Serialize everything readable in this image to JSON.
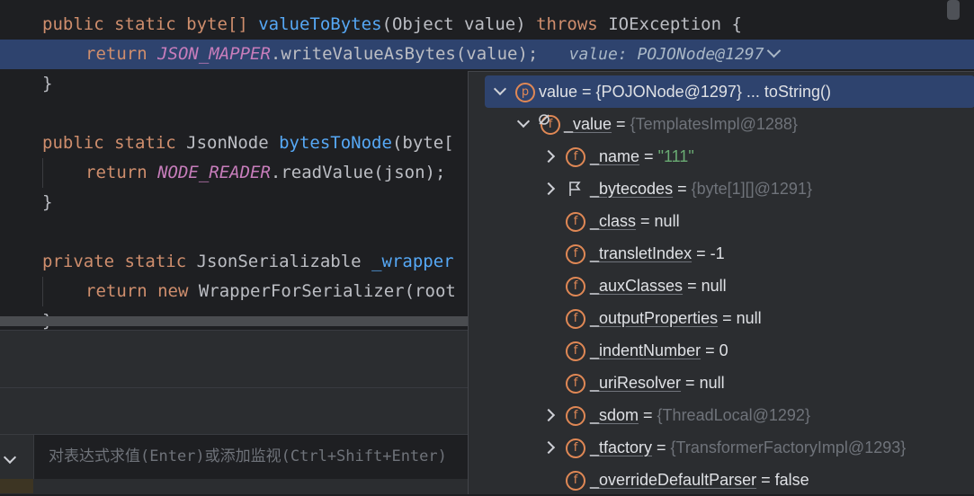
{
  "editor": {
    "lines": [
      {
        "k1": "public static ",
        "t1": "byte[] ",
        "fn": "valueToBytes",
        "rest": "(Object value) ",
        "kw2": "throws",
        "rest2": " IOException {"
      },
      {
        "ret": "return ",
        "const": "JSON_MAPPER",
        "call": ".writeValueAsBytes(value);",
        "hint": "value: POJONode@1297"
      },
      {
        "brace": "}"
      },
      {
        "k1": "public static ",
        "t1": "JsonNode ",
        "fn": "bytesToNode",
        "rest": "(byte["
      },
      {
        "ret": "return ",
        "const": "NODE_READER",
        "call": ".readValue(json);"
      },
      {
        "brace": "}"
      },
      {
        "k1": "private static ",
        "t1": "JsonSerializable ",
        "fn": "_wrapper"
      },
      {
        "ret": "return ",
        "kw": "new ",
        "call": "WrapperForSerializer(root"
      },
      {
        "brace": "}"
      }
    ]
  },
  "evaluate": {
    "placeholder": "对表达式求值(Enter)或添加监视(Ctrl+Shift+Enter)"
  },
  "popup": {
    "root": {
      "badge": "p",
      "text": "value = {POJONode@1297} ... toString()"
    },
    "value_node": {
      "badge": "f",
      "name": "_value",
      "eq": " = ",
      "ref": "{TemplatesImpl@1288}"
    },
    "fields": [
      {
        "badge": "f",
        "name": "_name",
        "eq": " = ",
        "val": "\"111\"",
        "type": "str",
        "expandable": true
      },
      {
        "badge": "flag",
        "name": "_bytecodes",
        "eq": " = ",
        "val": "{byte[1][]@1291}",
        "type": "ref",
        "expandable": true
      },
      {
        "badge": "f",
        "name": "_class",
        "eq": " = ",
        "val": "null",
        "type": "plain",
        "expandable": false
      },
      {
        "badge": "f",
        "name": "_transletIndex",
        "eq": " = ",
        "val": "-1",
        "type": "plain",
        "expandable": false
      },
      {
        "badge": "f",
        "name": "_auxClasses",
        "eq": " = ",
        "val": "null",
        "type": "plain",
        "expandable": false
      },
      {
        "badge": "f",
        "name": "_outputProperties",
        "eq": " = ",
        "val": "null",
        "type": "plain",
        "expandable": false
      },
      {
        "badge": "f",
        "name": "_indentNumber",
        "eq": " = ",
        "val": "0",
        "type": "plain",
        "expandable": false
      },
      {
        "badge": "f",
        "name": "_uriResolver",
        "eq": " = ",
        "val": "null",
        "type": "plain",
        "expandable": false
      },
      {
        "badge": "f",
        "name": "_sdom",
        "eq": " = ",
        "val": "{ThreadLocal@1292}",
        "type": "ref",
        "expandable": true
      },
      {
        "badge": "f",
        "name": "_tfactory",
        "eq": " = ",
        "val": "{TransformerFactoryImpl@1293}",
        "type": "ref",
        "expandable": true
      },
      {
        "badge": "f",
        "name": "_overrideDefaultParser",
        "eq": " = ",
        "val": "false",
        "type": "plain",
        "expandable": false
      }
    ]
  }
}
